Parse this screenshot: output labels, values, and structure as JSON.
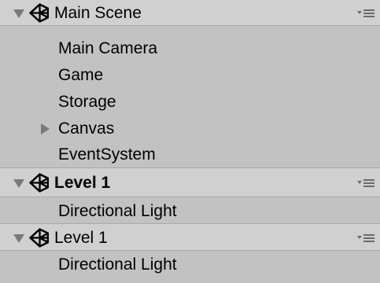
{
  "colors": {
    "panel_background": "#c2c2c2",
    "scene_header_background": "#d0d0d0",
    "foldout_arrow": "#7a7a7a",
    "text": "#000000"
  },
  "scenes": [
    {
      "name": "Main Scene",
      "bold": false,
      "expanded": true,
      "icon": "unity-scene-icon",
      "menu_icon": "scene-options-menu-icon",
      "items": [
        {
          "label": "Main Camera",
          "has_children": false
        },
        {
          "label": "Game",
          "has_children": false
        },
        {
          "label": "Storage",
          "has_children": false
        },
        {
          "label": "Canvas",
          "has_children": true,
          "expanded": false
        },
        {
          "label": "EventSystem",
          "has_children": false
        }
      ]
    },
    {
      "name": "Level  1",
      "bold": true,
      "expanded": true,
      "icon": "unity-scene-icon",
      "menu_icon": "scene-options-menu-icon",
      "items": [
        {
          "label": "Directional Light",
          "has_children": false
        }
      ]
    },
    {
      "name": "Level 1",
      "bold": false,
      "expanded": true,
      "icon": "unity-scene-icon",
      "menu_icon": "scene-options-menu-icon",
      "items": [
        {
          "label": "Directional Light",
          "has_children": false
        }
      ]
    }
  ]
}
